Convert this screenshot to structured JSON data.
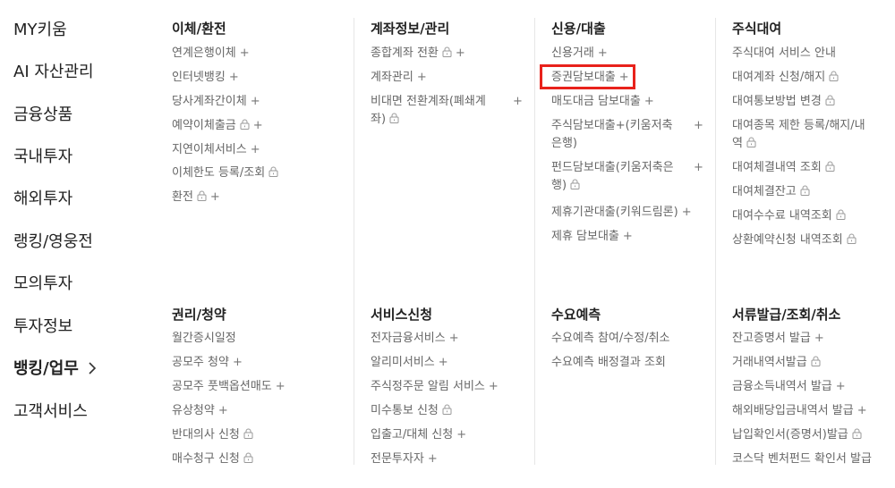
{
  "sidebar": {
    "items": [
      {
        "label": "MY키움"
      },
      {
        "label": "AI 자산관리"
      },
      {
        "label": "금융상품"
      },
      {
        "label": "국내투자"
      },
      {
        "label": "해외투자"
      },
      {
        "label": "랭킹/영웅전"
      },
      {
        "label": "모의투자"
      },
      {
        "label": "투자정보"
      },
      {
        "label": "뱅킹/업무",
        "chevron": "›"
      },
      {
        "label": "고객서비스"
      }
    ]
  },
  "sections": {
    "transfer": {
      "title": "이체/환전",
      "items": [
        {
          "label": "연계은행이체",
          "plus": "+"
        },
        {
          "label": "인터넷뱅킹",
          "plus": "+"
        },
        {
          "label": "당사계좌간이체",
          "plus": "+"
        },
        {
          "label": "예약이체출금",
          "lock": "lock-icon",
          "plus": "+"
        },
        {
          "label": "지연이체서비스",
          "plus": "+"
        },
        {
          "label": "이체한도 등록/조회",
          "lock": "lock-icon"
        },
        {
          "label": "환전",
          "lock": "lock-icon",
          "plus": "+"
        }
      ]
    },
    "account": {
      "title": "계좌정보/관리",
      "items": [
        {
          "label": "종합계좌 전환",
          "lock": "lock-icon",
          "plus": "+"
        },
        {
          "label": "계좌관리",
          "plus": "+"
        },
        {
          "label": "비대면 전환계좌(폐쇄계",
          "label2": "좌)",
          "lock": "lock-icon",
          "plus": "+"
        }
      ]
    },
    "credit": {
      "title": "신용/대출",
      "items": [
        {
          "label": "신용거래",
          "plus": "+"
        },
        {
          "label": "증권담보대출",
          "plus": "+"
        },
        {
          "label": "매도대금 담보대출",
          "plus": "+"
        },
        {
          "label": "주식담보대출+(키움저축",
          "label2": "은행)",
          "plus": "+"
        },
        {
          "label": "펀드담보대출(키움저축은",
          "label2": "행)",
          "lock": "lock-icon",
          "plus": "+"
        },
        {
          "label": "제휴기관대출(키워드림론)",
          "plus": "+"
        },
        {
          "label": "제휴 담보대출",
          "plus": "+"
        }
      ]
    },
    "lending": {
      "title": "주식대여",
      "items": [
        {
          "label": "주식대여 서비스 안내"
        },
        {
          "label": "대여계좌 신청/해지",
          "lock": "lock-icon"
        },
        {
          "label": "대여통보방법 변경",
          "lock": "lock-icon"
        },
        {
          "label": "대여종목 제한 등록/해지/내",
          "label2": "역",
          "lock": "lock-icon"
        },
        {
          "label": "대여체결내역 조회",
          "lock": "lock-icon"
        },
        {
          "label": "대여체결잔고",
          "lock": "lock-icon"
        },
        {
          "label": "대여수수료 내역조회",
          "lock": "lock-icon"
        },
        {
          "label": "상환예약신청 내역조회",
          "lock": "lock-icon"
        }
      ]
    },
    "rights": {
      "title": "권리/청약",
      "items": [
        {
          "label": "월간증시일정"
        },
        {
          "label": "공모주 청약",
          "plus": "+"
        },
        {
          "label": "공모주 풋백옵션매도",
          "plus": "+"
        },
        {
          "label": "유상청약",
          "plus": "+"
        },
        {
          "label": "반대의사 신청",
          "lock": "lock-icon"
        },
        {
          "label": "매수청구 신청",
          "lock": "lock-icon"
        }
      ]
    },
    "service": {
      "title": "서비스신청",
      "items": [
        {
          "label": "전자금융서비스",
          "plus": "+"
        },
        {
          "label": "알리미서비스",
          "plus": "+"
        },
        {
          "label": "주식정주문 알림 서비스",
          "plus": "+"
        },
        {
          "label": "미수통보 신청",
          "lock": "lock-icon"
        },
        {
          "label": "입출고/대체 신청",
          "plus": "+"
        },
        {
          "label": "전문투자자",
          "plus": "+"
        }
      ]
    },
    "forecast": {
      "title": "수요예측",
      "items": [
        {
          "label": "수요예측 참여/수정/취소"
        },
        {
          "label": "수요예측 배정결과 조회"
        }
      ]
    },
    "docs": {
      "title": "서류발급/조회/취소",
      "items": [
        {
          "label": "잔고증명서 발급",
          "plus": "+"
        },
        {
          "label": "거래내역서발급",
          "lock": "lock-icon"
        },
        {
          "label": "금융소득내역서 발급",
          "plus": "+"
        },
        {
          "label": "해외배당입금내역서 발급",
          "plus": "+"
        },
        {
          "label": "납입확인서(증명서)발급",
          "lock": "lock-icon"
        },
        {
          "label": "코스닥 벤처펀드 확인서 발급"
        }
      ]
    }
  },
  "highlight_color": "#e8221b"
}
